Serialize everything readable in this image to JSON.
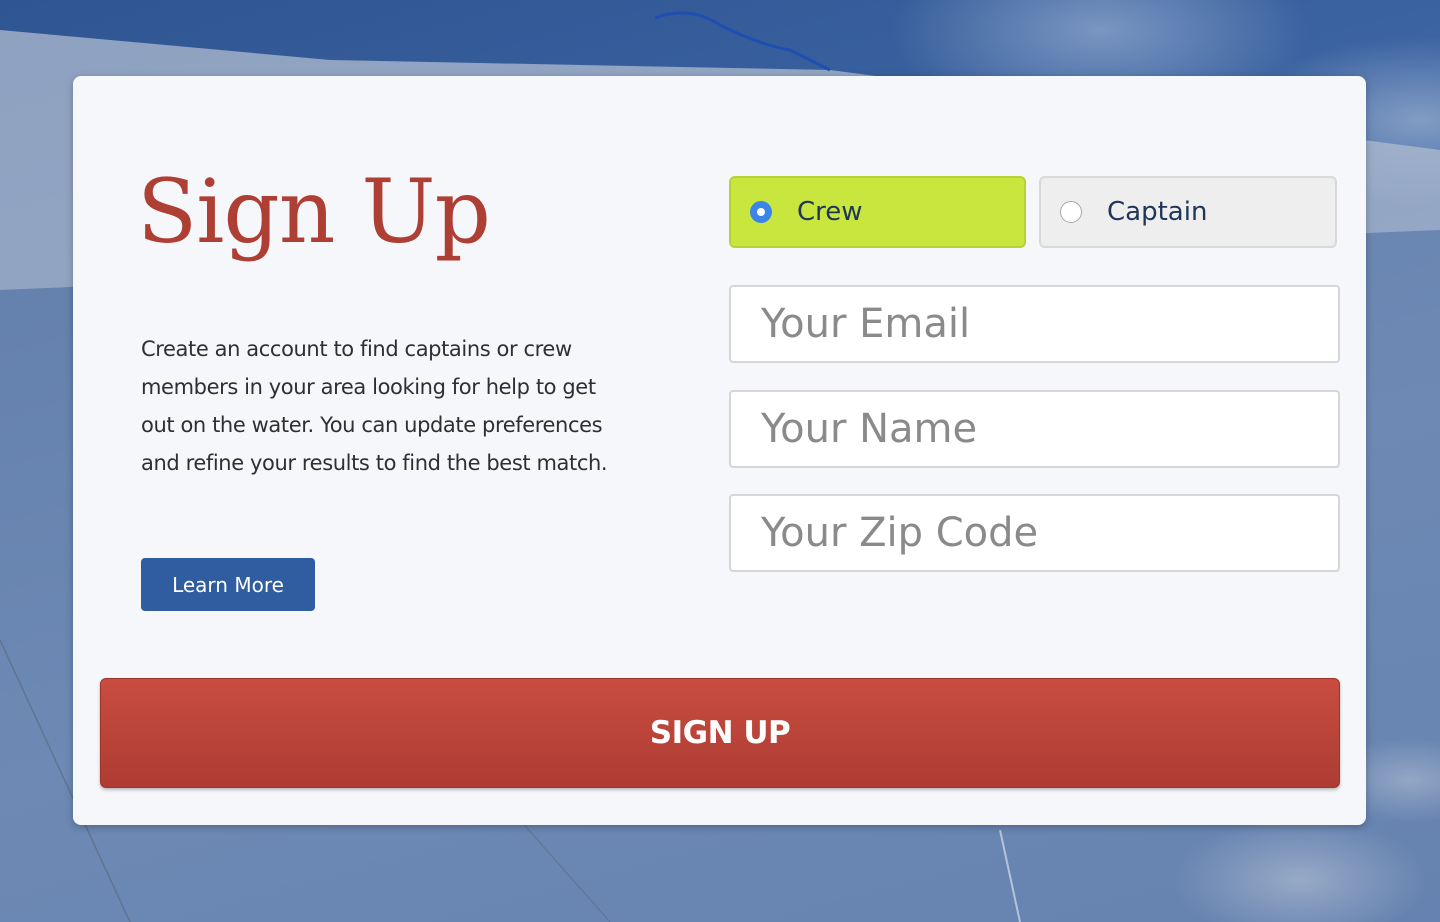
{
  "background": {
    "description_icon": "sail-and-sky-photo"
  },
  "signup": {
    "title": "Sign Up",
    "description": "Create an account to find captains or crew members in your area looking for help to get out on the water. You can update preferences and refine your results to find the best match.",
    "learn_more_label": "Learn More",
    "roles": [
      {
        "label": "Crew",
        "selected": true
      },
      {
        "label": "Captain",
        "selected": false
      }
    ],
    "fields": {
      "email": {
        "value": "",
        "placeholder": "Your Email"
      },
      "name": {
        "value": "",
        "placeholder": "Your Name"
      },
      "zip": {
        "value": "",
        "placeholder": "Your Zip Code"
      }
    },
    "submit_label": "SIGN UP"
  },
  "colors": {
    "title": "#ae3f35",
    "crew_selected": "#c9e63f",
    "captain_unselected": "#eeeeee",
    "learn_more": "#2f5da0",
    "signup_button": "#c0463b",
    "radio_checked": "#3a86e8"
  }
}
